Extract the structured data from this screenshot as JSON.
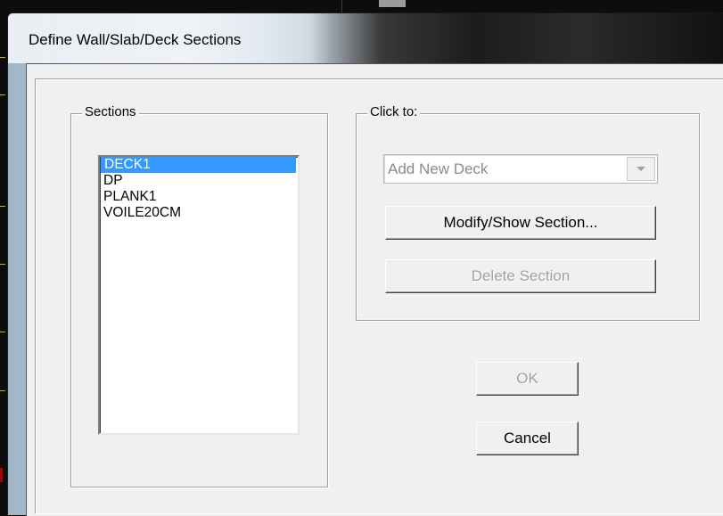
{
  "window": {
    "title": "Define Wall/Slab/Deck Sections"
  },
  "sections": {
    "group_label": "Sections",
    "items": [
      "DECK1",
      "DP",
      "PLANK1",
      "VOILE20CM"
    ],
    "selected": "DECK1"
  },
  "click_to": {
    "group_label": "Click to:",
    "combo_value": "Add New Deck",
    "modify_label": "Modify/Show Section...",
    "delete_label": "Delete Section"
  },
  "buttons": {
    "ok_label": "OK",
    "cancel_label": "Cancel"
  },
  "colors": {
    "selection": "#3399ff",
    "dialog_background": "#f0f0f0"
  }
}
